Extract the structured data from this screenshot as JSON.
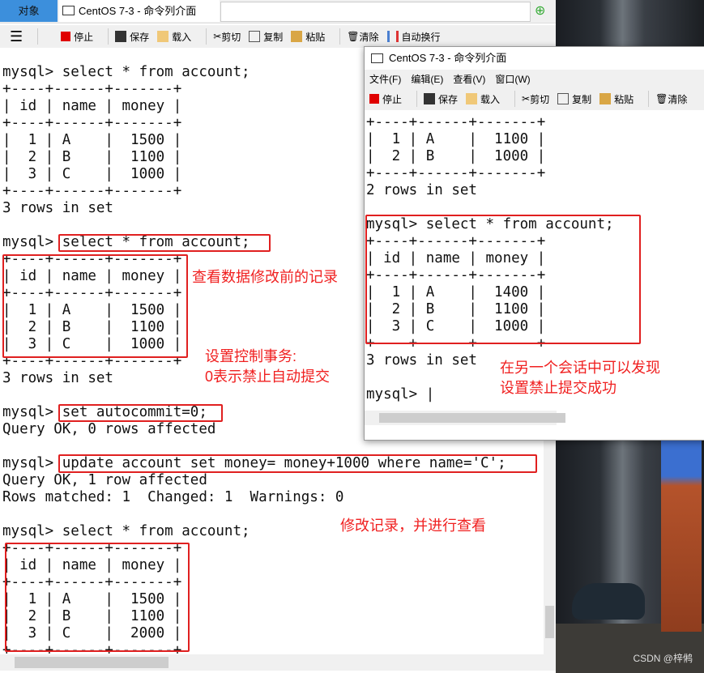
{
  "tabs": {
    "object": "对象",
    "main": "CentOS 7-3 - 命令列介面"
  },
  "toolbar": {
    "stop": "停止",
    "save": "保存",
    "load": "载入",
    "cut": "剪切",
    "copy": "复制",
    "paste": "粘贴",
    "clear": "清除",
    "wrap": "自动换行"
  },
  "window2": {
    "title": "CentOS 7-3 - 命令列介面",
    "menus": [
      "文件(F)",
      "编辑(E)",
      "查看(V)",
      "窗口(W)"
    ]
  },
  "colors": {
    "annotation": "#e02020",
    "stop": "#e00000",
    "tab_active": "#3c8fdc"
  },
  "left_terminal": [
    "mysql> select * from account;",
    "+----+------+-------+",
    "| id | name | money |",
    "+----+------+-------+",
    "|  1 | A    |  1500 |",
    "|  2 | B    |  1100 |",
    "|  3 | C    |  1000 |",
    "+----+------+-------+",
    "3 rows in set",
    "",
    "mysql> select * from account;",
    "+----+------+-------+",
    "| id | name | money |",
    "+----+------+-------+",
    "|  1 | A    |  1500 |",
    "|  2 | B    |  1100 |",
    "|  3 | C    |  1000 |",
    "+----+------+-------+",
    "3 rows in set",
    "",
    "mysql> set autocommit=0;",
    "Query OK, 0 rows affected",
    "",
    "mysql> update account set money= money+1000 where name='C';",
    "Query OK, 1 row affected",
    "Rows matched: 1  Changed: 1  Warnings: 0",
    "",
    "mysql> select * from account;",
    "+----+------+-------+",
    "| id | name | money |",
    "+----+------+-------+",
    "|  1 | A    |  1500 |",
    "|  2 | B    |  1100 |",
    "|  3 | C    |  2000 |",
    "+----+------+-------+"
  ],
  "right_terminal": [
    "+----+------+-------+",
    "|  1 | A    |  1100 |",
    "|  2 | B    |  1000 |",
    "+----+------+-------+",
    "2 rows in set",
    "",
    "mysql> select * from account;",
    "+----+------+-------+",
    "| id | name | money |",
    "+----+------+-------+",
    "|  1 | A    |  1400 |",
    "|  2 | B    |  1100 |",
    "|  3 | C    |  1000 |",
    "+----+------+-------+",
    "3 rows in set",
    "",
    "mysql> |"
  ],
  "annotations": {
    "before": "查看数据修改前的记录",
    "autocommit": "设置控制事务:\n0表示禁止自动提交",
    "modify": "修改记录，并进行查看",
    "other_session": "在另一个会话中可以发现\n设置禁止提交成功"
  },
  "watermark": "CSDN @梓鸺"
}
